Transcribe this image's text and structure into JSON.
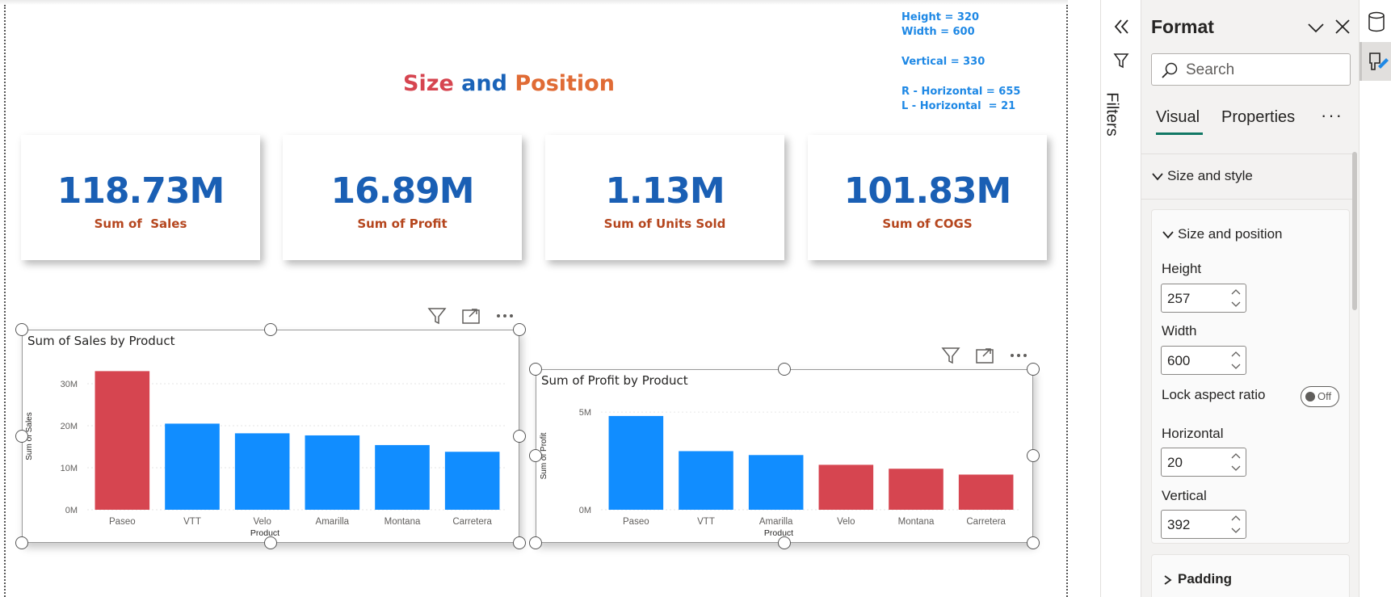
{
  "page": {
    "title_part1": "Size",
    "title_part2": "and",
    "title_part3": "Position",
    "notes": [
      "Height = 320",
      "Width = 600",
      "Vertical = 330",
      "R - Horizontal = 655",
      "L - Horizontal  = 21"
    ]
  },
  "cards": [
    {
      "value": "118.73M",
      "label": "Sum of  Sales"
    },
    {
      "value": "16.89M",
      "label": "Sum of Profit"
    },
    {
      "value": "1.13M",
      "label": "Sum of Units Sold"
    },
    {
      "value": "101.83M",
      "label": "Sum of COGS"
    }
  ],
  "colors": {
    "bar_blue": "#118DFF",
    "bar_red": "#D64550",
    "title_red": "#d64550",
    "title_blue": "#1a63b8",
    "title_orange": "#e06b35",
    "card_value": "#1a5fb4",
    "card_label": "#b5461e",
    "note": "#1e88e5"
  },
  "chart_data": [
    {
      "type": "bar",
      "title": "Sum of Sales by Product",
      "xlabel": "Product",
      "ylabel": "Sum of Sales",
      "categories": [
        "Paseo",
        "VTT",
        "Velo",
        "Amarilla",
        "Montana",
        "Carretera"
      ],
      "values": [
        33.0,
        20.5,
        18.2,
        17.7,
        15.4,
        13.8
      ],
      "highlight": [
        true,
        false,
        false,
        false,
        false,
        false
      ],
      "yticks": [
        "0M",
        "10M",
        "20M",
        "30M"
      ],
      "ytick_values": [
        0,
        10,
        20,
        30
      ],
      "ylim": [
        0,
        35
      ],
      "grid": true
    },
    {
      "type": "bar",
      "title": "Sum of Profit by Product",
      "xlabel": "Product",
      "ylabel": "Sum of Profit",
      "categories": [
        "Paseo",
        "VTT",
        "Amarilla",
        "Velo",
        "Montana",
        "Carretera"
      ],
      "values": [
        4.8,
        3.0,
        2.8,
        2.3,
        2.1,
        1.8
      ],
      "highlight": [
        false,
        false,
        false,
        true,
        true,
        true
      ],
      "yticks": [
        "0M",
        "5M"
      ],
      "ytick_values": [
        0,
        5
      ],
      "ylim": [
        0,
        5.5
      ],
      "grid": true
    }
  ],
  "filters": {
    "label": "Filters"
  },
  "format_pane": {
    "title": "Format",
    "search_placeholder": "Search",
    "tabs": [
      "Visual",
      "Properties"
    ],
    "more": "···",
    "section": "Size and style",
    "group": "Size and position",
    "fields": {
      "height_label": "Height",
      "height_value": "257",
      "width_label": "Width",
      "width_value": "600",
      "lock_label": "Lock aspect ratio",
      "lock_state": "Off",
      "horizontal_label": "Horizontal",
      "horizontal_value": "20",
      "vertical_label": "Vertical",
      "vertical_value": "392"
    },
    "padding": "Padding"
  }
}
